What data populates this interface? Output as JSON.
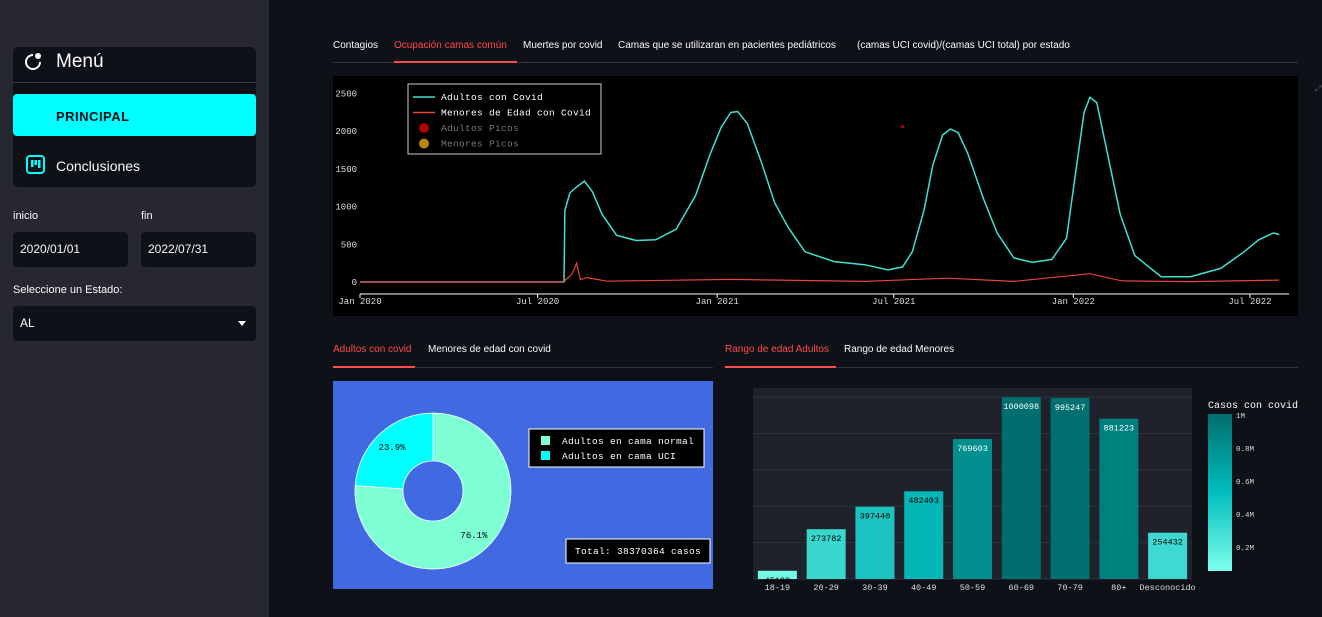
{
  "sidebar": {
    "menu_title": "Menú",
    "nav_items": [
      "PRINCIPAL",
      "Conclusiones"
    ],
    "start_label": "inicio",
    "start_value": "2020/01/01",
    "end_label": "fin",
    "end_value": "2022/07/31",
    "state_label": "Seleccione un Estado:",
    "state_value": "AL"
  },
  "main_tabs": [
    "Contagios",
    "Ocupación camas común",
    "Muertes por covid",
    "Camas que se utilizaran en pacientes pediátricos",
    "(camas UCI covid)/(camas UCI total) por estado"
  ],
  "pie_tabs": [
    "Adultos con covid",
    "Menores de edad con covid"
  ],
  "bar_tabs": [
    "Rango de edad Adultos",
    "Rango de edad Menores"
  ],
  "colors": {
    "accent": "#ff4b4b",
    "cyan": "#00ffff",
    "bg": "#0e1117",
    "sidebar": "#262730",
    "pie_bg": "#4169e1"
  },
  "chart_data": [
    {
      "type": "line",
      "x_ticks": [
        "Jan 2020",
        "Jul 2020",
        "Jan 2021",
        "Jul 2021",
        "Jan 2022",
        "Jul 2022"
      ],
      "y_ticks": [
        "0",
        "500",
        "1000",
        "1500",
        "2000",
        "2500"
      ],
      "ylim": [
        0,
        2600
      ],
      "legend": [
        "Adultos con Covid",
        "Menores de Edad con Covid",
        "Adultos Picos",
        "Menores Picos"
      ],
      "legend_position": "top-left",
      "series": [
        {
          "name": "Adultos con Covid",
          "color": "#40e0d0",
          "points": [
            [
              "2020-01-01",
              0
            ],
            [
              "2020-07-28",
              0
            ],
            [
              "2020-07-29",
              950
            ],
            [
              "2020-08-03",
              1180
            ],
            [
              "2020-08-10",
              1260
            ],
            [
              "2020-08-18",
              1340
            ],
            [
              "2020-08-26",
              1200
            ],
            [
              "2020-09-05",
              900
            ],
            [
              "2020-09-20",
              620
            ],
            [
              "2020-10-10",
              550
            ],
            [
              "2020-10-30",
              560
            ],
            [
              "2020-11-20",
              700
            ],
            [
              "2020-12-10",
              1150
            ],
            [
              "2020-12-25",
              1700
            ],
            [
              "2021-01-05",
              2050
            ],
            [
              "2021-01-15",
              2250
            ],
            [
              "2021-01-22",
              2260
            ],
            [
              "2021-02-01",
              2100
            ],
            [
              "2021-02-15",
              1600
            ],
            [
              "2021-03-01",
              1050
            ],
            [
              "2021-03-15",
              720
            ],
            [
              "2021-04-01",
              400
            ],
            [
              "2021-05-01",
              270
            ],
            [
              "2021-06-01",
              230
            ],
            [
              "2021-06-25",
              160
            ],
            [
              "2021-07-10",
              200
            ],
            [
              "2021-07-20",
              400
            ],
            [
              "2021-08-01",
              950
            ],
            [
              "2021-08-10",
              1550
            ],
            [
              "2021-08-20",
              1950
            ],
            [
              "2021-08-28",
              2030
            ],
            [
              "2021-09-05",
              1980
            ],
            [
              "2021-09-15",
              1700
            ],
            [
              "2021-10-01",
              1100
            ],
            [
              "2021-10-15",
              650
            ],
            [
              "2021-11-01",
              320
            ],
            [
              "2021-11-20",
              260
            ],
            [
              "2021-12-10",
              300
            ],
            [
              "2021-12-25",
              580
            ],
            [
              "2022-01-05",
              1600
            ],
            [
              "2022-01-12",
              2250
            ],
            [
              "2022-01-18",
              2450
            ],
            [
              "2022-01-25",
              2380
            ],
            [
              "2022-02-05",
              1700
            ],
            [
              "2022-02-18",
              900
            ],
            [
              "2022-03-05",
              350
            ],
            [
              "2022-04-01",
              70
            ],
            [
              "2022-05-01",
              70
            ],
            [
              "2022-06-01",
              180
            ],
            [
              "2022-06-25",
              400
            ],
            [
              "2022-07-10",
              560
            ],
            [
              "2022-07-25",
              650
            ],
            [
              "2022-07-31",
              630
            ]
          ]
        },
        {
          "name": "Menores de Edad con Covid",
          "color": "#e8433d",
          "points": [
            [
              "2020-01-01",
              0
            ],
            [
              "2020-07-28",
              0
            ],
            [
              "2020-07-30",
              30
            ],
            [
              "2020-08-05",
              100
            ],
            [
              "2020-08-10",
              250
            ],
            [
              "2020-08-14",
              30
            ],
            [
              "2020-08-20",
              60
            ],
            [
              "2020-09-10",
              10
            ],
            [
              "2021-01-15",
              35
            ],
            [
              "2021-06-01",
              8
            ],
            [
              "2021-08-25",
              50
            ],
            [
              "2021-11-01",
              8
            ],
            [
              "2022-01-18",
              110
            ],
            [
              "2022-02-20",
              15
            ],
            [
              "2022-05-01",
              5
            ],
            [
              "2022-07-31",
              25
            ]
          ]
        }
      ],
      "peaks": [
        {
          "name": "Adultos Picos",
          "color": "#ad0000",
          "points": [
            [
              "2021-07-10",
              2060
            ]
          ]
        },
        {
          "name": "Menores Picos",
          "color": "#b8860b",
          "points": []
        }
      ]
    },
    {
      "type": "pie",
      "legend": [
        "Adultos en cama normal",
        "Adultos en cama UCI"
      ],
      "values": [
        76.1,
        23.9
      ],
      "labels": [
        "76.1%",
        "23.9%"
      ],
      "colors": [
        "#7fffd4",
        "#00ffff"
      ],
      "total_label": "Total: 38370364 casos"
    },
    {
      "type": "bar",
      "categories": [
        "18-19",
        "20-29",
        "30-39",
        "40-49",
        "50-59",
        "60-69",
        "70-79",
        "80+",
        "Desconocido"
      ],
      "values": [
        45193,
        273782,
        397440,
        482403,
        769603,
        1000098,
        995247,
        881223,
        254432
      ],
      "ylim": [
        0,
        1050000
      ],
      "colorbar_title": "Casos con covid",
      "colorbar_ticks": [
        "1M",
        "0.8M",
        "0.6M",
        "0.4M",
        "0.2M"
      ]
    }
  ]
}
